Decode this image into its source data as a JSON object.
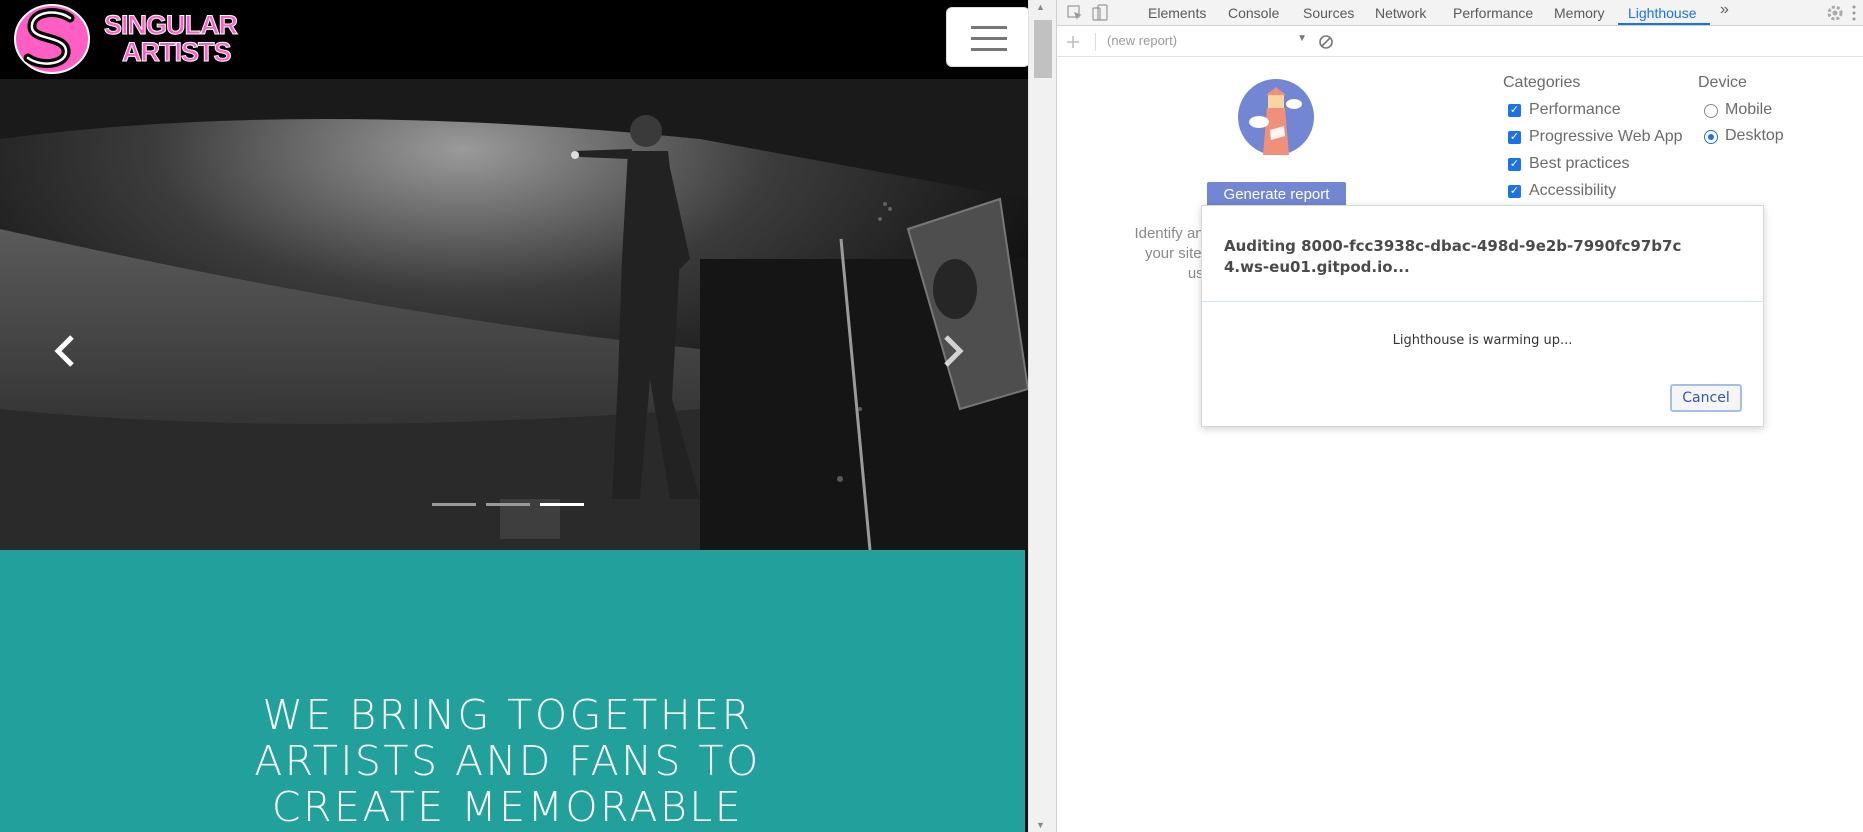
{
  "site": {
    "logo": {
      "line1": "SINGULAR",
      "line2": "ARTISTS",
      "mark": "S"
    },
    "menu_icon": "hamburger-menu-icon",
    "carousel": {
      "prev_icon": "chevron-left-icon",
      "next_icon": "chevron-right-icon",
      "indicator_count": 3,
      "active_indicator": 3
    },
    "tagline": [
      "WE BRING TOGETHER",
      "ARTISTS AND FANS TO",
      "CREATE MEMORABLE"
    ],
    "colors": {
      "teal": "#22a19c",
      "logo_pink": "#ff5ec4",
      "header": "#000000"
    }
  },
  "devtools": {
    "tabs": [
      "Elements",
      "Console",
      "Sources",
      "Network",
      "Performance",
      "Memory",
      "Lighthouse"
    ],
    "active_tab": "Lighthouse",
    "more_tabs_icon": "double-chevron-right-icon",
    "toolbar": {
      "add_icon": "plus-icon",
      "report_select": "(new report)",
      "clear_icon": "block-icon"
    },
    "lighthouse": {
      "generate_label": "Generate report",
      "description": "Identify and your site's use",
      "description_lines": [
        "Identify and",
        "your site's",
        "use"
      ],
      "categories_title": "Categories",
      "categories": [
        {
          "label": "Performance",
          "checked": true
        },
        {
          "label": "Progressive Web App",
          "checked": true
        },
        {
          "label": "Best practices",
          "checked": true
        },
        {
          "label": "Accessibility",
          "checked": true
        }
      ],
      "device_title": "Device",
      "devices": [
        {
          "label": "Mobile",
          "selected": false
        },
        {
          "label": "Desktop",
          "selected": true
        }
      ]
    },
    "dialog": {
      "title": "Auditing 8000-fcc3938c-dbac-498d-9e2b-7990fc97b7c4.ws-eu01.gitpod.io...",
      "status": "Lighthouse is warming up...",
      "cancel_label": "Cancel"
    },
    "colors": {
      "accent": "#1a73e8",
      "generate_button": "#7386d4"
    }
  }
}
